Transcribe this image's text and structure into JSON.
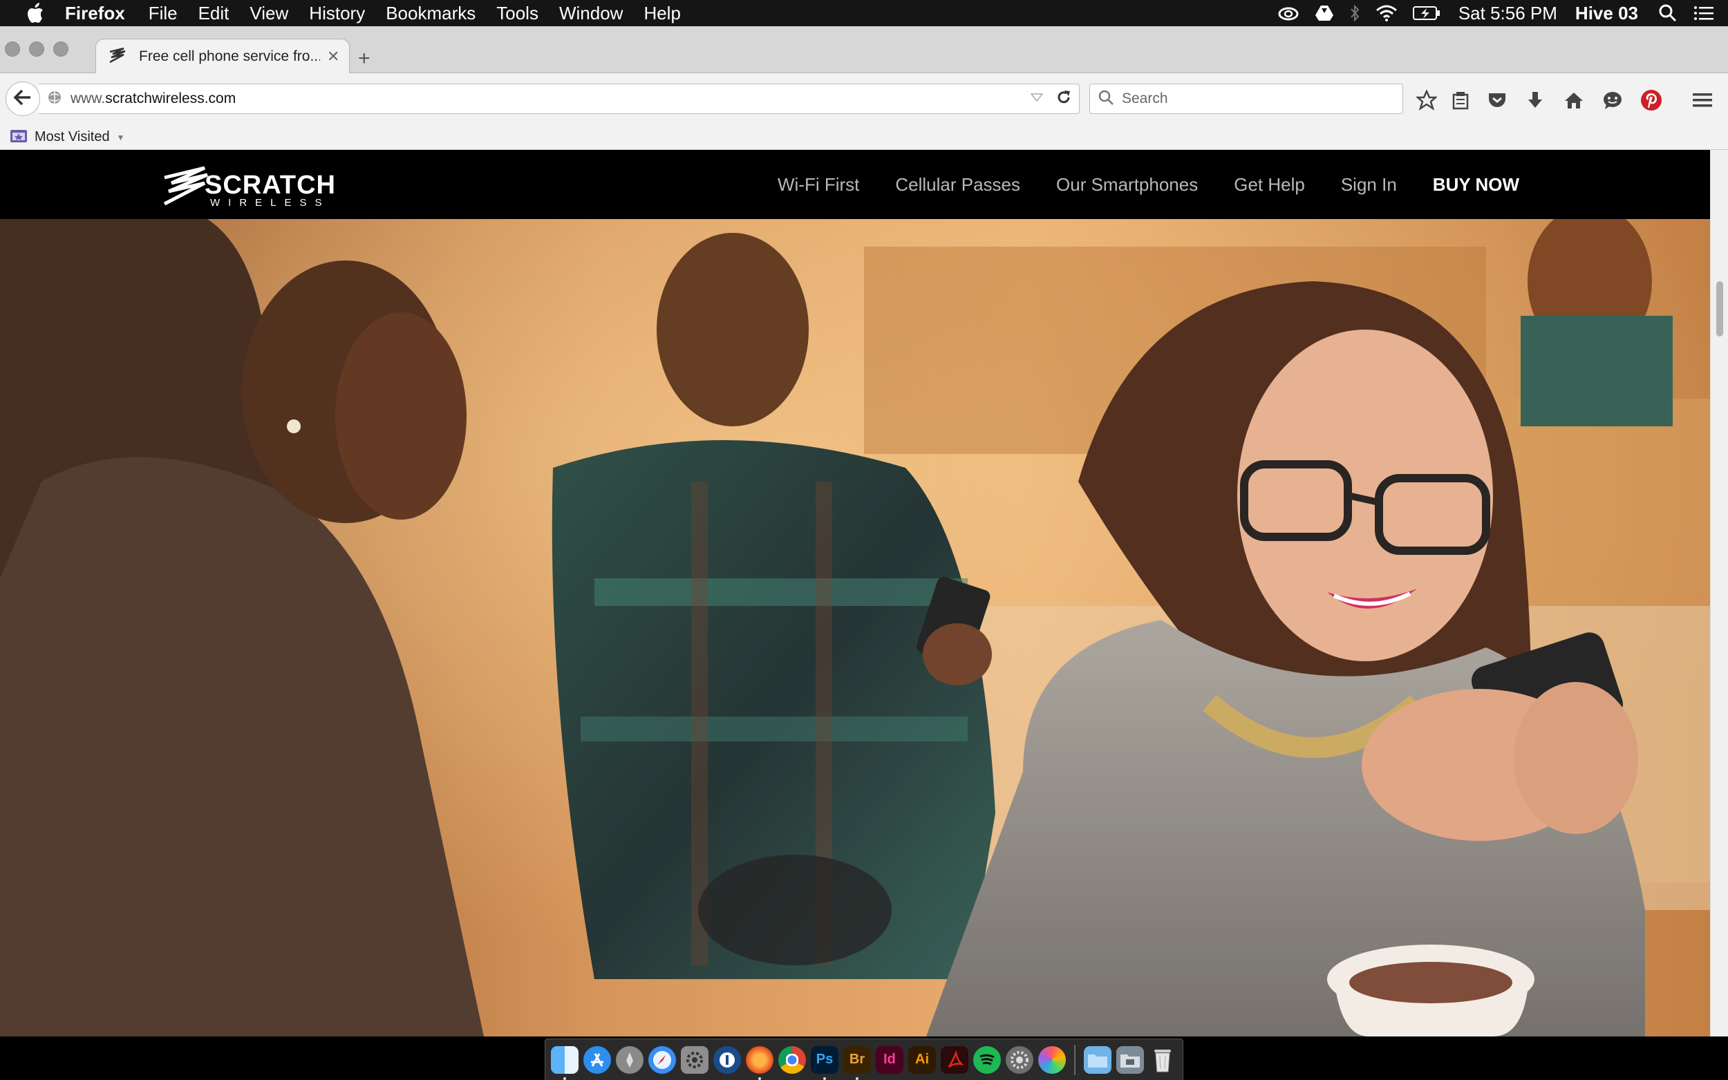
{
  "menubar": {
    "app_name": "Firefox",
    "items": [
      "File",
      "Edit",
      "View",
      "History",
      "Bookmarks",
      "Tools",
      "Window",
      "Help"
    ],
    "clock": "Sat 5:56 PM",
    "user": "Hive 03"
  },
  "browser": {
    "tab_title": "Free cell phone service fro...",
    "new_tab_label": "+",
    "url_prefix": "www.",
    "url_domain": "scratchwireless.com",
    "search_placeholder": "Search",
    "bookmark_label": "Most Visited"
  },
  "site": {
    "logo_text": "SCRATCH",
    "logo_subtext": "WIRELESS",
    "nav": [
      "Wi-Fi First",
      "Cellular Passes",
      "Our Smartphones",
      "Get Help",
      "Sign In"
    ],
    "buy_now": "BUY NOW"
  },
  "dock": {
    "labels": [
      "Ps",
      "Br",
      "Id",
      "Ai"
    ]
  },
  "colors": {
    "site_nav_bg": "#000000",
    "buy_now": "#ffffff",
    "nav_link": "#b9b9b9",
    "photoshop": "#001c33",
    "bridge": "#3a2200",
    "indesign": "#49021f",
    "illustrator": "#2e1a00"
  }
}
